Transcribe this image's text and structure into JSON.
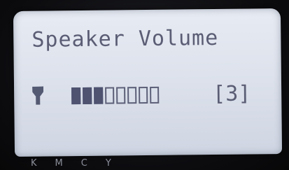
{
  "screen": {
    "title": "Speaker Volume",
    "level": 3,
    "max_level": 8,
    "level_label": "[3]"
  },
  "icons": {
    "speaker": "speaker-icon"
  },
  "keys": [
    "K",
    "M",
    "C",
    "Y"
  ],
  "colors": {
    "lcd_background": "#dde2ec",
    "lcd_text": "#5a5d74",
    "bezel": "#0d0d10"
  }
}
